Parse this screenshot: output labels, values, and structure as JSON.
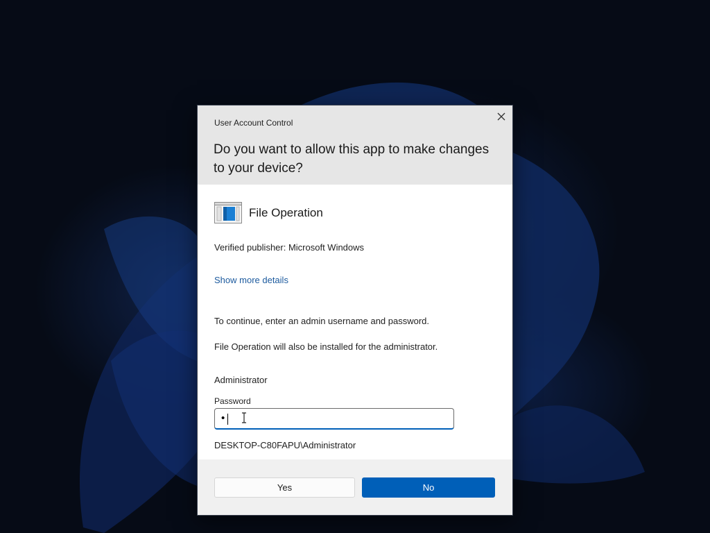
{
  "dialog": {
    "caption": "User Account Control",
    "question": "Do you want to allow this app to make changes to your device?",
    "app": {
      "name": "File Operation",
      "icon": "file-operation-icon"
    },
    "publisher": "Verified publisher: Microsoft Windows",
    "details_link": "Show more details",
    "instruction": "To continue, enter an admin username and password.",
    "install_note": "File Operation will also be installed for the administrator.",
    "account": {
      "username": "Administrator",
      "password_label": "Password",
      "password_value": "•",
      "domain_user": "DESKTOP-C80FAPU\\Administrator"
    },
    "buttons": {
      "yes": "Yes",
      "no": "No"
    },
    "colors": {
      "accent": "#005fb8",
      "link": "#1c5a9e",
      "header_bg": "#e6e6e6",
      "footer_bg": "#f0f0f0"
    }
  }
}
